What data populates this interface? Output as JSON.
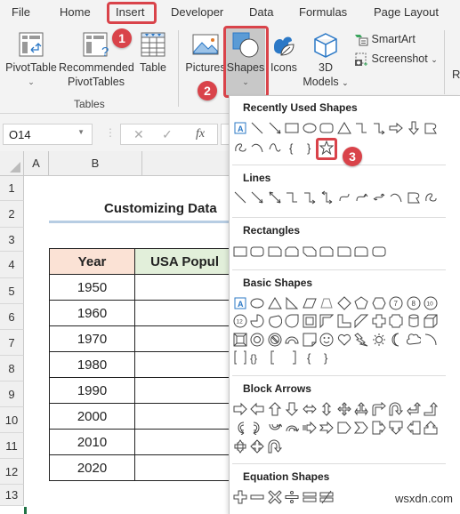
{
  "tabs": [
    {
      "label": "File"
    },
    {
      "label": "Home"
    },
    {
      "label": "Insert",
      "active": true
    },
    {
      "label": "Developer"
    },
    {
      "label": "Data"
    },
    {
      "label": "Formulas"
    },
    {
      "label": "Page Layout"
    }
  ],
  "ribbon": {
    "tables_group": {
      "label": "Tables",
      "pivottable": "PivotTable",
      "recommended_line1": "Recommended",
      "recommended_line2": "PivotTables",
      "table": "Table"
    },
    "illustrations": {
      "pictures": "Pictures",
      "shapes": "Shapes",
      "icons": "Icons",
      "models_line1": "3D",
      "models_line2": "Models",
      "smartart": "SmartArt",
      "screenshot": "Screenshot",
      "cut_off_letter": "R"
    },
    "chevron": "⌄"
  },
  "callouts": [
    "1",
    "2",
    "3"
  ],
  "formula_bar": {
    "name_box": "O14",
    "cancel": "✕",
    "enter": "✓",
    "fx": "fx"
  },
  "sheet": {
    "columns": [
      "A",
      "B"
    ],
    "rows": [
      "1",
      "2",
      "3",
      "4",
      "5",
      "6",
      "7",
      "8",
      "9",
      "10",
      "11",
      "12",
      "13"
    ],
    "title": "Customizing Data",
    "table": {
      "headers": [
        "Year",
        "USA Popul"
      ],
      "years": [
        "1950",
        "1960",
        "1970",
        "1980",
        "1990",
        "2000",
        "2010",
        "2020"
      ]
    }
  },
  "shapes_menu": {
    "sections": [
      {
        "title": "Recently Used Shapes"
      },
      {
        "title": "Lines"
      },
      {
        "title": "Rectangles"
      },
      {
        "title": "Basic Shapes"
      },
      {
        "title": "Block Arrows"
      },
      {
        "title": "Equation Shapes"
      }
    ],
    "selected_shape": "star-5-point"
  },
  "watermark": "wsxdn.com",
  "colors": {
    "accent_red": "#d9434a",
    "year_header_bg": "#fbe2d5",
    "pop_header_bg": "#e2efda",
    "title_underline": "#b7cde3"
  }
}
